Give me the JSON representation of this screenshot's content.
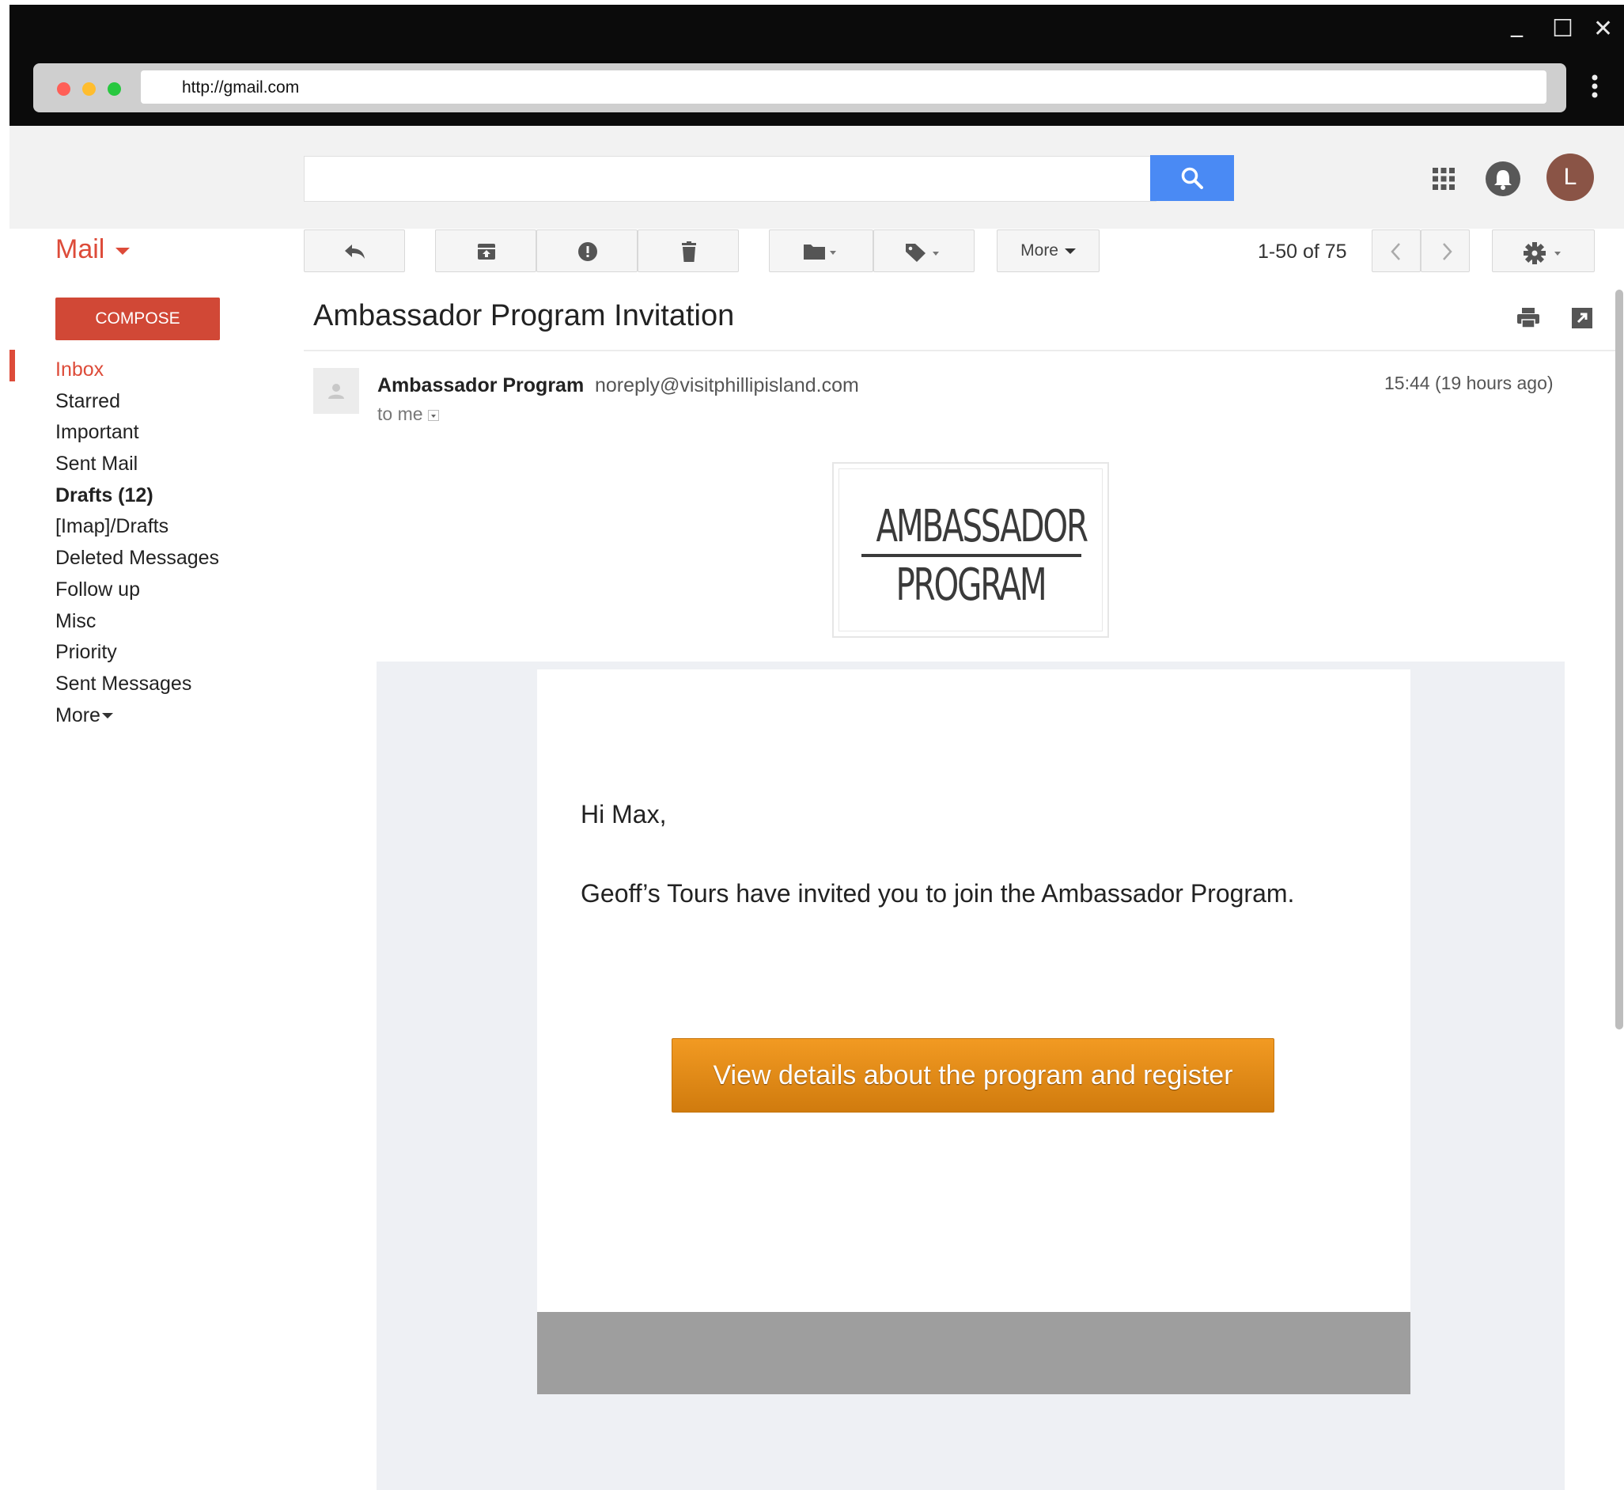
{
  "browser": {
    "url": "http://gmail.com",
    "window_controls": {
      "minimize": "_",
      "maximize": "☐",
      "close": "✕"
    }
  },
  "header": {
    "search_placeholder": "",
    "avatar_letter": "L",
    "icons": [
      "search-icon",
      "apps-icon",
      "bell-icon"
    ]
  },
  "toolbar": {
    "mail_label": "Mail",
    "more_label": "More",
    "pagination": "1-50 of 75",
    "icons": [
      "reply-icon",
      "archive-icon",
      "report-spam-icon",
      "delete-icon",
      "folder-icon",
      "label-icon",
      "chevron-left-icon",
      "chevron-right-icon",
      "gear-icon"
    ]
  },
  "sidebar": {
    "compose_label": "COMPOSE",
    "items": [
      {
        "label": "Inbox",
        "active": true
      },
      {
        "label": "Starred"
      },
      {
        "label": "Important"
      },
      {
        "label": "Sent Mail"
      },
      {
        "label": "Drafts (12)",
        "bold": true
      },
      {
        "label": "[Imap]/Drafts"
      },
      {
        "label": "Deleted Messages"
      },
      {
        "label": "Follow up"
      },
      {
        "label": "Misc"
      },
      {
        "label": "Priority"
      },
      {
        "label": "Sent Messages"
      },
      {
        "label": "More"
      }
    ]
  },
  "message": {
    "subject": "Ambassador Program Invitation",
    "sender_name": "Ambassador Program",
    "sender_email": "noreply@visitphillipisland.com",
    "to_line": "to me",
    "timestamp": "15:44 (19 hours ago)"
  },
  "email_body": {
    "logo_line1": "AMBASSADOR",
    "logo_line2": "PROGRAM",
    "greeting": "Hi Max,",
    "text": "Geoff’s Tours have invited you to join the Ambassador Program.",
    "cta_label": "View details about the program and register",
    "cta_color": "#e58b16"
  },
  "colors": {
    "gmail_red": "#dd4b39",
    "compose_red": "#d14836",
    "search_blue": "#4a8af4",
    "avatar_brown": "#8a5446"
  }
}
